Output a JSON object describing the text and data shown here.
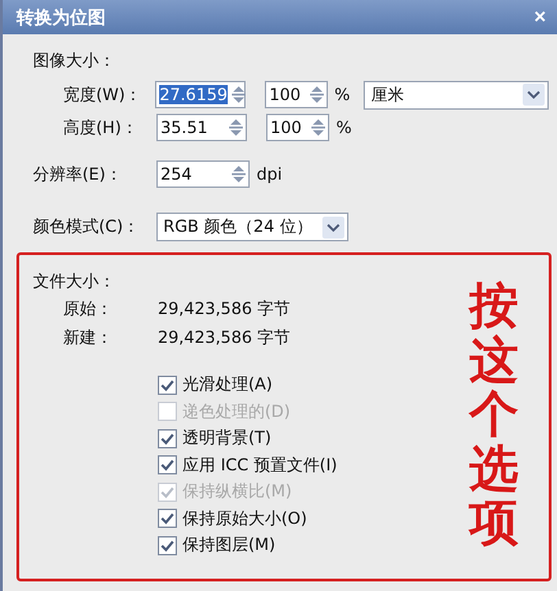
{
  "window": {
    "title": "转换为位图",
    "close": "×"
  },
  "image_size": {
    "heading": "图像大小：",
    "rows": [
      {
        "label": "宽度(W)：",
        "value": "27.6159",
        "selected": true,
        "percent": "100",
        "percent_unit": "%",
        "unit": "厘米"
      },
      {
        "label": "高度(H)：",
        "value": "35.51",
        "selected": false,
        "percent": "100",
        "percent_unit": "%"
      }
    ]
  },
  "resolution": {
    "label": "分辨率(E)：",
    "value": "254",
    "unit": "dpi"
  },
  "color_mode": {
    "label": "颜色模式(C)：",
    "value": "RGB 颜色（24 位）"
  },
  "file_size": {
    "heading": "文件大小：",
    "rows": [
      {
        "label": "原始：",
        "value": "29,423,586 字节"
      },
      {
        "label": "新建：",
        "value": "29,423,586 字节"
      }
    ]
  },
  "options": [
    {
      "label": "光滑处理(A)",
      "checked": true,
      "disabled": false
    },
    {
      "label": "递色处理的(D)",
      "checked": false,
      "disabled": true
    },
    {
      "label": "透明背景(T)",
      "checked": true,
      "disabled": false
    },
    {
      "label": "应用 ICC 预置文件(I)",
      "checked": true,
      "disabled": false
    },
    {
      "label": "保持纵横比(M)",
      "checked": true,
      "disabled": true
    },
    {
      "label": "保持原始大小(O)",
      "checked": true,
      "disabled": false
    },
    {
      "label": "保持图层(M)",
      "checked": true,
      "disabled": false
    }
  ],
  "annotation": {
    "text": "按这个选项"
  }
}
